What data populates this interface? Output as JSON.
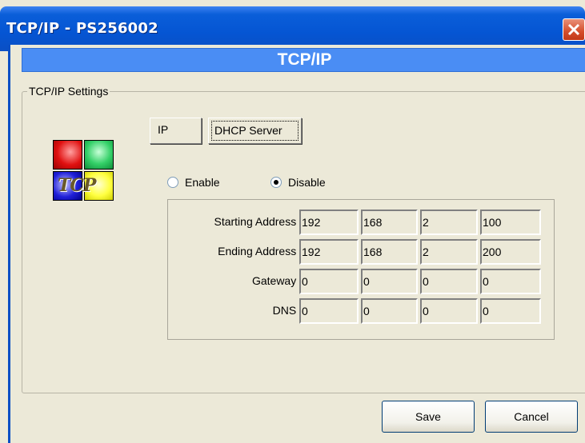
{
  "window": {
    "title": "TCP/IP - PS256002",
    "banner": "TCP/IP"
  },
  "settings": {
    "group_label": "TCP/IP Settings",
    "tabs": [
      {
        "label": "IP"
      },
      {
        "label": "DHCP Server",
        "active": true
      }
    ],
    "dhcp": {
      "enable_label": "Enable",
      "disable_label": "Disable",
      "selected": "Disable",
      "rows": [
        {
          "label": "Starting Address :",
          "octets": [
            "192",
            "168",
            "2",
            "100"
          ]
        },
        {
          "label": "Ending Address :",
          "octets": [
            "192",
            "168",
            "2",
            "200"
          ]
        },
        {
          "label": "Gateway :",
          "octets": [
            "0",
            "0",
            "0",
            "0"
          ]
        },
        {
          "label": "DNS :",
          "octets": [
            "0",
            "0",
            "0",
            "0"
          ]
        }
      ]
    }
  },
  "buttons": {
    "save": "Save",
    "cancel": "Cancel"
  },
  "logo": {
    "text": "TCP",
    "colors": [
      "#e01010",
      "#34d068",
      "#2020d8",
      "#ffff40"
    ]
  },
  "colors": {
    "titlebar": "#0555d3",
    "banner": "#4a8df4",
    "dialog_bg": "#ece9d8",
    "close": "#d54e2c"
  }
}
